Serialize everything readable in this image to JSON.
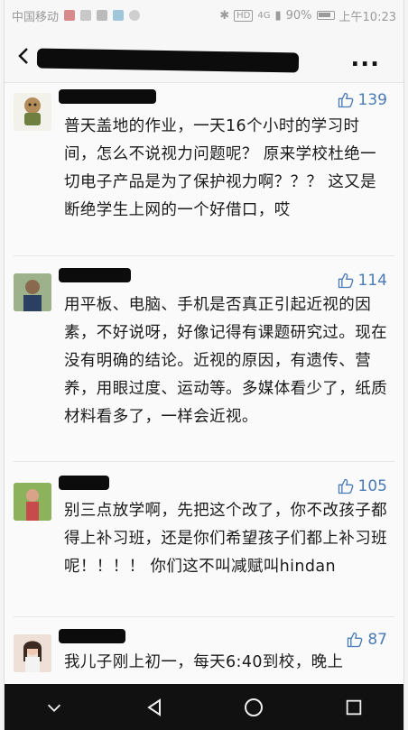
{
  "status_bar": {
    "carrier": "中国移动",
    "network": "4G",
    "battery": "90%",
    "time": "上午10:23"
  },
  "title_bar": {
    "more_label": "..."
  },
  "comments": [
    {
      "likes": "139",
      "text": "普天盖地的作业，一天16个小时的学习时间，怎么不说视力问题呢？ 原来学校杜绝一切电子产品是为了保护视力啊？？？ 这又是断绝学生上网的一个好借口，哎"
    },
    {
      "likes": "114",
      "text": "用平板、电脑、手机是否真正引起近视的因素，不好说呀，好像记得有课题研究过。现在没有明确的结论。近视的原因，有遗传、营养，用眼过度、运动等。多媒体看少了，纸质材料看多了，一样会近视。"
    },
    {
      "likes": "105",
      "text": "别三点放学啊，先把这个改了，你不改孩子都得上补习班，还是你们希望孩子们都上补习班呢！！！！ 你们这不叫减赋叫hindan"
    },
    {
      "likes": "87",
      "text": "我儿子刚上初一，每天6:40到校，晚上"
    }
  ],
  "nav_bar": {
    "icons": [
      "chevron-down-icon",
      "back-triangle-icon",
      "home-circle-icon",
      "recents-square-icon"
    ]
  }
}
